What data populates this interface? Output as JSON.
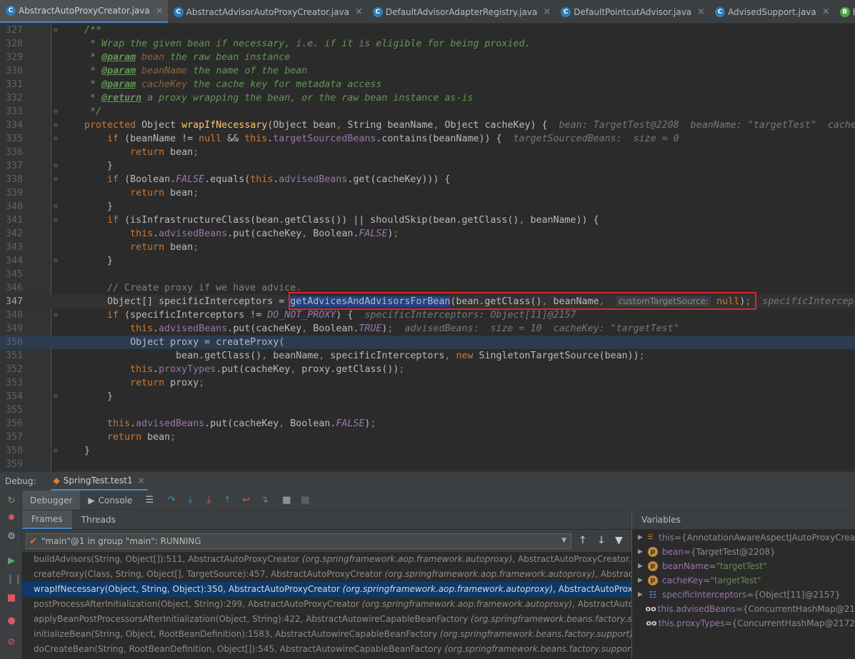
{
  "tabs": [
    {
      "label": "AbstractAutoProxyCreator.java",
      "active": true,
      "icon": "class-icon"
    },
    {
      "label": "AbstractAdvisorAutoProxyCreator.java",
      "active": false,
      "icon": "class-icon"
    },
    {
      "label": "DefaultAdvisorAdapterRegistry.java",
      "active": false,
      "icon": "class-icon"
    },
    {
      "label": "DefaultPointcutAdvisor.java",
      "active": false,
      "icon": "class-icon"
    },
    {
      "label": "AdvisedSupport.java",
      "active": false,
      "icon": "class-icon"
    },
    {
      "label": "BeanPo",
      "active": false,
      "icon": "bean-icon"
    }
  ],
  "editor": {
    "line_numbers": [
      "327",
      "328",
      "329",
      "330",
      "331",
      "332",
      "333",
      "334",
      "335",
      "336",
      "337",
      "338",
      "339",
      "340",
      "341",
      "342",
      "343",
      "344",
      "345",
      "346",
      "347",
      "348",
      "349",
      "350",
      "351",
      "352",
      "353",
      "354",
      "355",
      "356",
      "357",
      "358",
      "359"
    ],
    "current_line": "347",
    "exec_line": "350",
    "lines": {
      "l327": "/**",
      "l328": " * Wrap the given bean if necessary, i.e. if it is eligible for being proxied.",
      "l329_tag": "@param",
      "l329_name": "bean",
      "l329_rest": " the raw bean instance",
      "l330_tag": "@param",
      "l330_name": "beanName",
      "l330_rest": " the name of the bean",
      "l331_tag": "@param",
      "l331_name": "cacheKey",
      "l331_rest": " the cache key for metadata access",
      "l332_tag": "@return",
      "l332_rest": " a proxy wrapping the bean, or the raw bean instance as-is",
      "l333": " */",
      "l334_hint": "bean: TargetTest@2208  beanName: \"targetTest\"  cacheKey",
      "l335_hint": "targetSourcedBeans:  size = 0",
      "l346": "// Create proxy if we have advice.",
      "l347_method": "getAdvicesAndAdvisorsForBean",
      "l347_param_hint": "customTargetSource:",
      "l347_tail_hint": "specificIntercept",
      "l348_hint": "specificInterceptors: Object[11]@2157",
      "l349_hint": "advisedBeans:  size = 10  cacheKey: \"targetTest\""
    }
  },
  "debug": {
    "title": "Debug:",
    "session": "SpringTest.test1",
    "tab_debugger": "Debugger",
    "tab_console": "Console",
    "tab_frames": "Frames",
    "tab_threads": "Threads",
    "thread_label": "\"main\"@1 in group \"main\": RUNNING",
    "frames": [
      {
        "method": "buildAdvisors(String, Object[]):511, AbstractAutoProxyCreator ",
        "pkg": "(org.springframework.aop.framework.autoproxy)",
        "file": ", AbstractAutoProxyCreator.java",
        "selected": false
      },
      {
        "method": "createProxy(Class, String, Object[], TargetSource):457, AbstractAutoProxyCreator ",
        "pkg": "(org.springframework.aop.framework.autoproxy)",
        "file": ", AbstractAuto",
        "selected": false
      },
      {
        "method": "wrapIfNecessary(Object, String, Object):350, AbstractAutoProxyCreator ",
        "pkg": "(org.springframework.aop.framework.autoproxy)",
        "file": ", AbstractAutoProxyCre",
        "selected": true
      },
      {
        "method": "postProcessAfterInitialization(Object, String):299, AbstractAutoProxyCreator ",
        "pkg": "(org.springframework.aop.framework.autoproxy)",
        "file": ", AbstractAutoProx",
        "selected": false
      },
      {
        "method": "applyBeanPostProcessorsAfterInitialization(Object, String):422, AbstractAutowireCapableBeanFactory ",
        "pkg": "(org.springframework.beans.factory.suppo",
        "file": "",
        "selected": false
      },
      {
        "method": "initializeBean(String, Object, RootBeanDefinition):1583, AbstractAutowireCapableBeanFactory ",
        "pkg": "(org.springframework.beans.factory.support)",
        "file": ", Abst",
        "selected": false
      },
      {
        "method": "doCreateBean(String, RootBeanDefinition, Object[]):545, AbstractAutowireCapableBeanFactory ",
        "pkg": "(org.springframework.beans.factory.support)",
        "file": ", Ab",
        "selected": false
      }
    ],
    "variables_title": "Variables",
    "variables": [
      {
        "name": "this",
        "value": "{AnnotationAwareAspectJAutoProxyCrea",
        "kind": "field",
        "str": false
      },
      {
        "name": "bean",
        "value": "{TargetTest@2208}",
        "kind": "param",
        "str": false
      },
      {
        "name": "beanName",
        "value": "\"targetTest\"",
        "kind": "param",
        "str": true
      },
      {
        "name": "cacheKey",
        "value": "\"targetTest\"",
        "kind": "param",
        "str": true
      },
      {
        "name": "specificInterceptors",
        "value": "{Object[11]@2157}",
        "kind": "list",
        "str": false
      },
      {
        "name": "this.advisedBeans",
        "value": "{ConcurrentHashMap@21",
        "kind": "watch",
        "str": false
      },
      {
        "name": "this.proxyTypes",
        "value": "{ConcurrentHashMap@2172",
        "kind": "watch",
        "str": false
      }
    ]
  },
  "colors": {
    "accent": "#4a88c7",
    "selection": "#0d3a6b",
    "highlight_box": "#e0242a"
  }
}
